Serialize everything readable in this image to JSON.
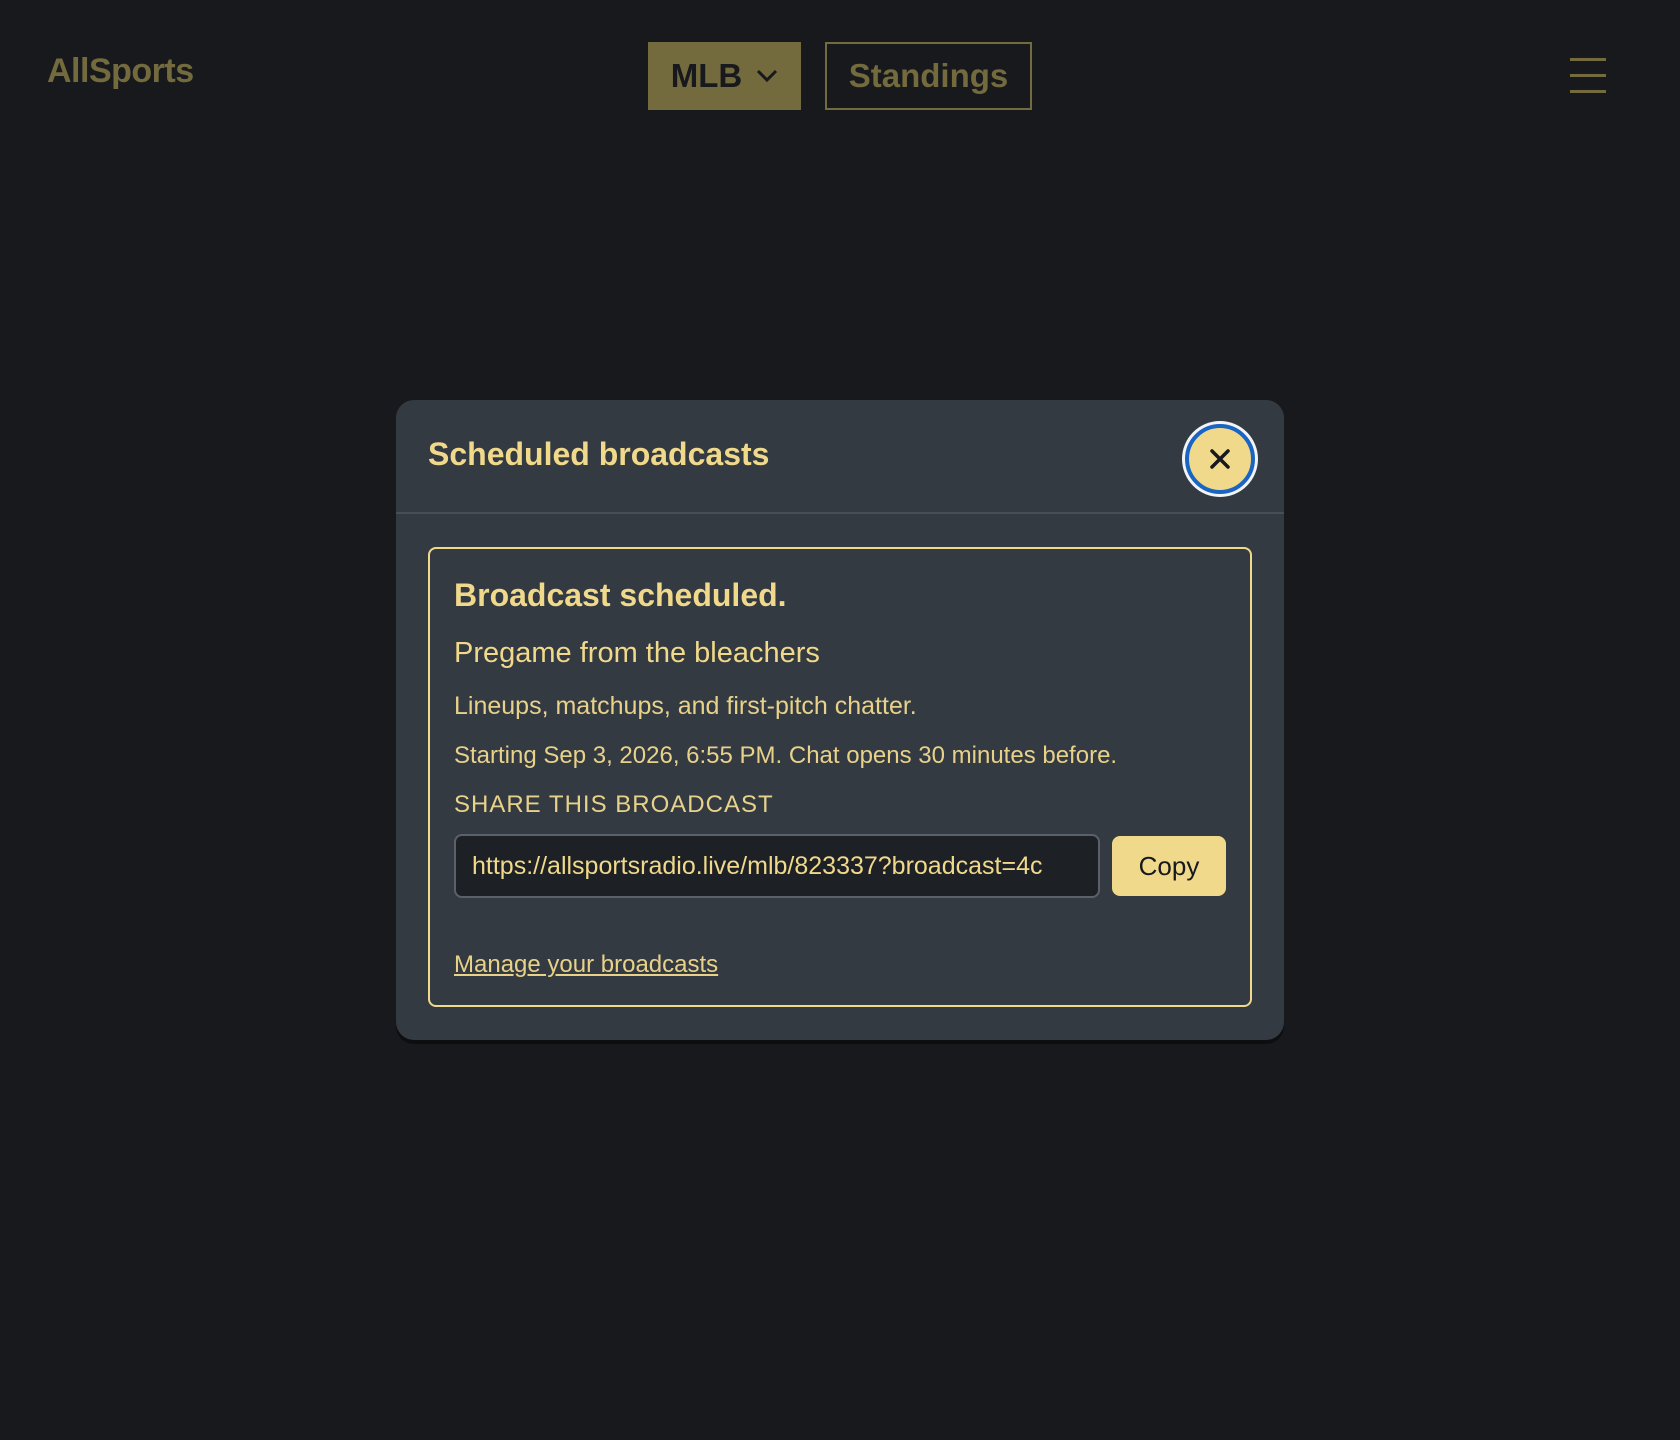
{
  "header": {
    "brand": "AllSports",
    "league_label": "MLB",
    "standings_label": "Standings"
  },
  "modal": {
    "title": "Scheduled broadcasts",
    "confirmation": {
      "heading": "Broadcast scheduled.",
      "show_title": "Pregame from the bleachers",
      "description": "Lineups, matchups, and first-pitch chatter.",
      "schedule_text": "Starting Sep 3, 2026, 6:55 PM. Chat opens 30 minutes before.",
      "share_label": "SHARE THIS BROADCAST",
      "share_url": "https://allsportsradio.live/mlb/823337?broadcast=4c",
      "copy_label": "Copy",
      "manage_link": "Manage your broadcasts"
    }
  },
  "icons": {
    "league": "chevron-down-icon",
    "menu": "hamburger-menu-icon",
    "close": "close-icon"
  },
  "colors": {
    "background": "#17191d",
    "accent": "#f0d98a",
    "muted_accent": "#736a3e",
    "modal_bg": "#343a42",
    "focus_ring": "#1a64c4"
  }
}
